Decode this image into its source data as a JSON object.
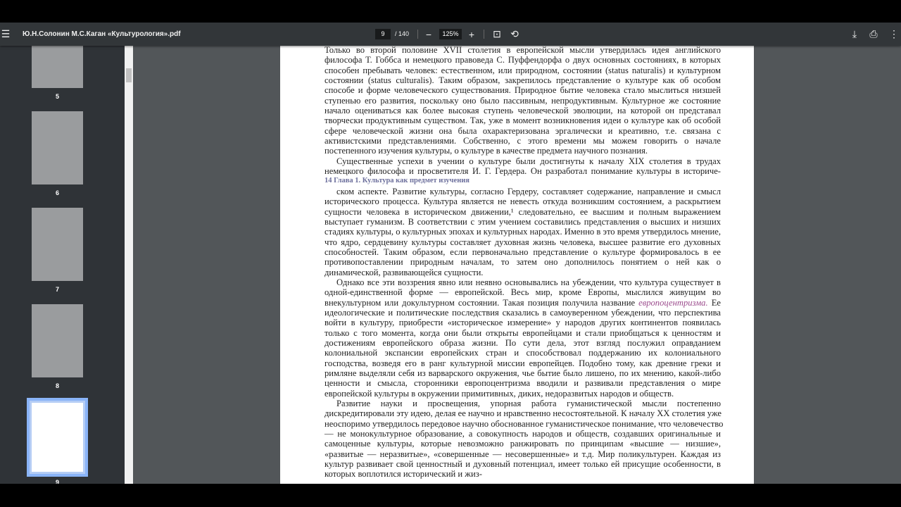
{
  "toolbar": {
    "title": "Ю.Н.Солонин М.С.Каган «Культурология».pdf",
    "current_page": "9",
    "total_pages": "/ 140",
    "zoom": "125%",
    "menu_icon": "☰",
    "zoom_out": "−",
    "zoom_in": "+",
    "fit_icon": "⊡",
    "rotate_icon": "⟲",
    "download_icon": "⤓",
    "print_icon": "⎙",
    "more_icon": "⋮"
  },
  "sidebar": {
    "thumbnails": [
      {
        "label": "5"
      },
      {
        "label": "6"
      },
      {
        "label": "7"
      },
      {
        "label": "8"
      },
      {
        "label": "9",
        "selected": true
      }
    ]
  },
  "document": {
    "lines": [
      {
        "t": "Только во второй половине XVII столетия в европейской мысли утвердилась идея английского",
        "c": ""
      },
      {
        "t": "философа Т. Гоббса и немецкого правоведа С. Пуффендорфа о двух основных состояниях, в которых",
        "c": ""
      },
      {
        "t": "способен пребывать человек: естественном, или природном, состоянии (status naturalis) и культурном",
        "c": ""
      },
      {
        "t": "состоянии (status culturalis). Таким образом, закрепилось представление о культуре как об особом",
        "c": ""
      },
      {
        "t": "способе и форме человеческого существования. Природное бытие человека стало мыслиться низшей",
        "c": ""
      },
      {
        "t": "ступенью его развития, поскольку оно было пассивным, непродуктивным. Культурное же состояние",
        "c": ""
      },
      {
        "t": "начало оцениваться как более высокая ступень человеческой эволюции, на которой он представал",
        "c": ""
      },
      {
        "t": "творчески продуктивным существом. Так, уже в момент возникновения идеи о культуре как об особой",
        "c": ""
      },
      {
        "t": "сфере человеческой жизни она была охарактеризована эргалически и креативно, т.е. связана с",
        "c": ""
      },
      {
        "t": "активистскими представлениями. Собственно, с этого времени мы можем говорить о начале",
        "c": ""
      },
      {
        "t": "постепенного изучения культуры, о культуре в качестве предмета научного познания.",
        "c": "last"
      },
      {
        "t": "Существенные успехи в учении о культуре были достигнуты к началу XIX столетия в трудах",
        "c": "first"
      },
      {
        "t": "немецкого философа и просветителя И. Г. Гердера. Он разработал понимание культуры в историче-",
        "c": ""
      },
      {
        "t": "14 Глава 1. Культура как предмет изучения",
        "c": "heading"
      },
      {
        "t": "ском аспекте. Развитие культуры, согласно Гердеру, составляет содержание, направление и смысл",
        "c": "first"
      },
      {
        "t": "исторического процесса. Культура является не невесть откуда возникшим состоянием, а раскрытием",
        "c": ""
      },
      {
        "t": "сущности человека в историческом движении,¹ следовательно, ее высшим и полным выражением",
        "c": ""
      },
      {
        "t": "выступает гуманизм. В соответствии с этим учением составились представления о высших и низших",
        "c": ""
      },
      {
        "t": "стадиях культуры, о культурных эпохах и культурных народах. Именно в это время утвердилось мнение,",
        "c": ""
      },
      {
        "t": "что ядро, сердцевину культуры составляет духовная жизнь человека, высшее развитие его духовных",
        "c": ""
      },
      {
        "t": "способностей. Таким образом, если первоначально представление о культуре формировалось в ее",
        "c": ""
      },
      {
        "t": "противопоставлении природным началам, то затем оно дополнилось понятием о ней как о",
        "c": ""
      },
      {
        "t": "динамической, развивающейся сущности.",
        "c": "last"
      },
      {
        "t": "Однако все эти воззрения явно или неявно основывались на убеждении, что культура существует в",
        "c": "first"
      },
      {
        "t": "одной-единственной форме — европейской. Весь мир, кроме Европы, мыслился живущим во",
        "c": ""
      },
      {
        "parts": [
          "внекультурном или докультурном состоянии. Такая позиция получила название ",
          "европоцентризма.",
          " Ее"
        ],
        "c": ""
      },
      {
        "t": "идеологические и политические последствия сказались в самоуверенном убеждении, что перспектива",
        "c": ""
      },
      {
        "t": "войти в культуру, приобрести «историческое измерение» у народов других континентов появилась",
        "c": ""
      },
      {
        "t": "только с того момента, когда они были открыты европейцами и стали приобщаться к ценностям и",
        "c": ""
      },
      {
        "t": "достижениям европейского образа жизни. По сути дела, этот взгляд послужил оправданием",
        "c": ""
      },
      {
        "t": "колониальной экспансии европейских стран и способствовал поддержанию их колониального",
        "c": ""
      },
      {
        "t": "господства, возведя его в ранг культурной миссии европейцев. Подобно тому, как древние греки и",
        "c": ""
      },
      {
        "t": "римляне выделяли себя из варварского окружения, чье бытие было лишено, по их мнению, какой-либо",
        "c": ""
      },
      {
        "t": "ценности и смысла, сторонники европоцентризма вводили и развивали представления о мире",
        "c": ""
      },
      {
        "t": "европейской культуры в окружении примитивных, диких, недоразвитых народов и обществ.",
        "c": "last"
      },
      {
        "t": "Развитие науки и просвещения, упорная работа гуманистической мысли постепенно",
        "c": "first"
      },
      {
        "t": "дискредитировали эту идею, делая ее научно и нравственно несостоятельной. К началу XX столетия уже",
        "c": ""
      },
      {
        "t": "неоспоримо утвердилось передовое научно обоснованное гуманистическое понимание, что человечество",
        "c": ""
      },
      {
        "t": "— не монокультурное образование, а совокупность народов и обществ, создавших оригинальные и",
        "c": ""
      },
      {
        "t": "самоценные культуры, которые невозможно ранжировать по принципам «высшие — низшие»,",
        "c": ""
      },
      {
        "t": "«развитые — неразвитые», «совершенные — несовершенные» и т.д. Мир поликультурен. Каждая из",
        "c": ""
      },
      {
        "t": "культур развивает свой ценностный и духовный потенциал, имеет только ей присущие особенности, в",
        "c": ""
      },
      {
        "t": "которых воплотился исторический и жиз-",
        "c": "last"
      }
    ]
  }
}
